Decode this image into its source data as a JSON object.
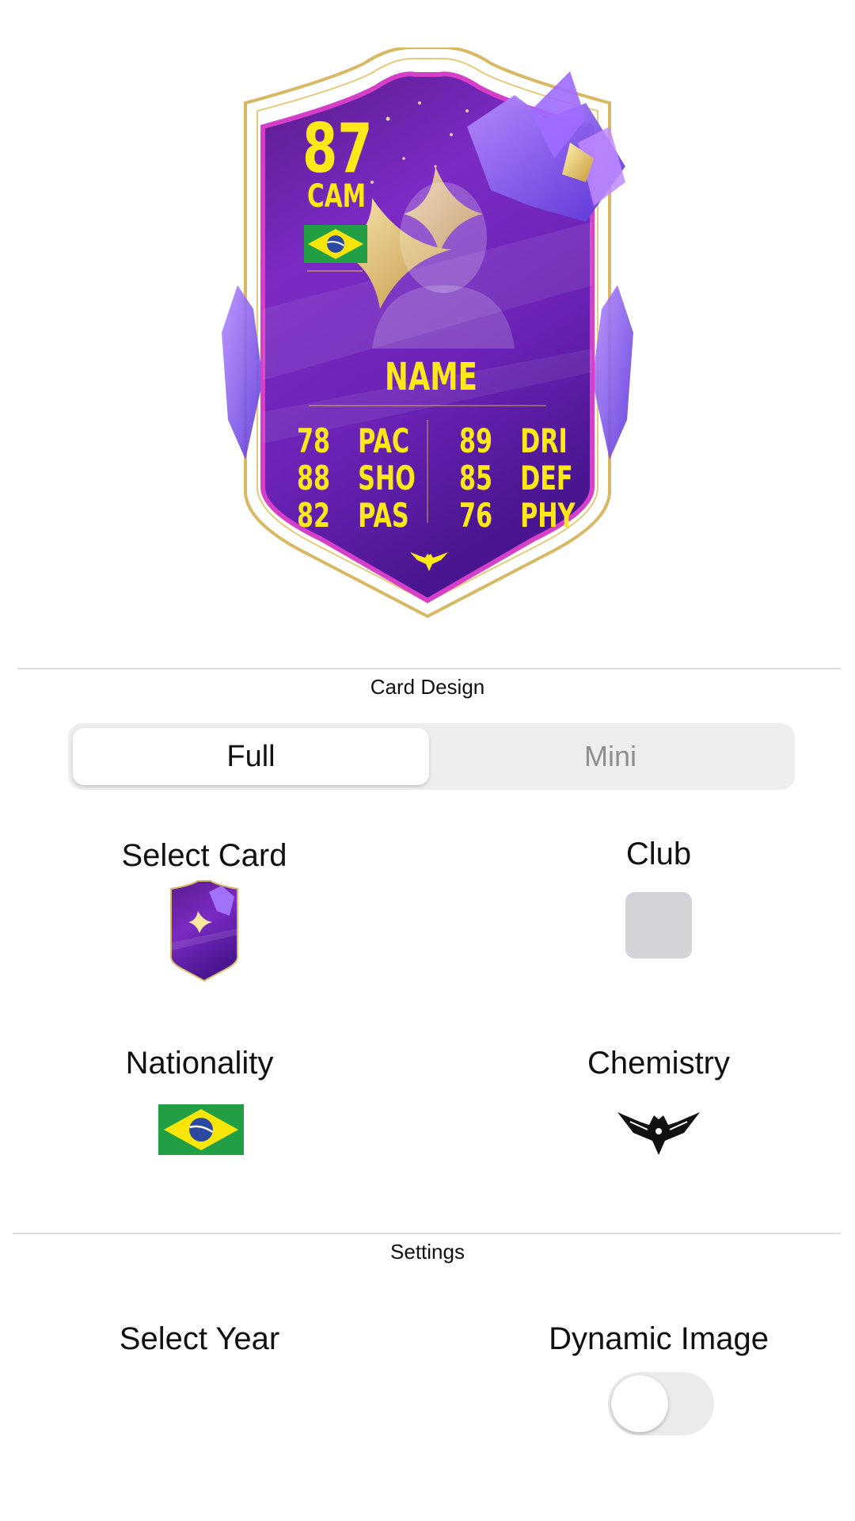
{
  "card": {
    "rating": "87",
    "position": "CAM",
    "name": "NAME",
    "stats": [
      {
        "value": "78",
        "label": "PAC"
      },
      {
        "value": "88",
        "label": "SHO"
      },
      {
        "value": "82",
        "label": "PAS"
      },
      {
        "value": "89",
        "label": "DRI"
      },
      {
        "value": "85",
        "label": "DEF"
      },
      {
        "value": "76",
        "label": "PHY"
      }
    ],
    "nation_icon": "brazil-flag",
    "chemistry_icon": "eagle-emblem",
    "colors": {
      "accent": "#ffe81a",
      "card_purple": "#6a1fb0",
      "card_border": "#c9a24a"
    }
  },
  "card_design": {
    "title": "Card Design",
    "segments": {
      "full": "Full",
      "mini": "Mini"
    },
    "selected_segment": "Full",
    "select_card_label": "Select Card",
    "club_label": "Club",
    "nationality_label": "Nationality",
    "chemistry_label": "Chemistry"
  },
  "settings": {
    "title": "Settings",
    "select_year_label": "Select Year",
    "dynamic_image_label": "Dynamic Image",
    "dynamic_image_on": false
  }
}
